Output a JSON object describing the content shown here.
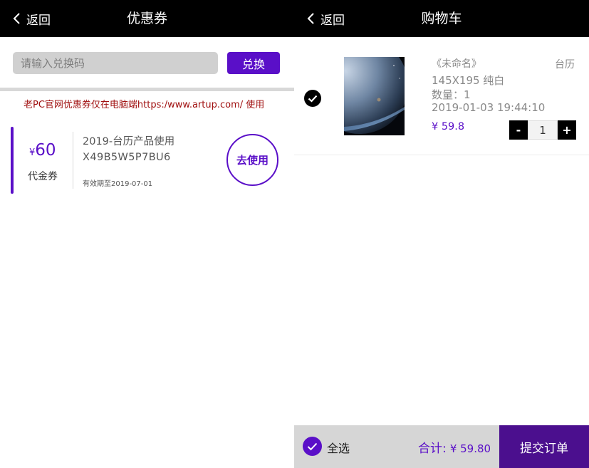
{
  "coupons_screen": {
    "back_label": "返回",
    "title": "优惠券",
    "redeem": {
      "placeholder": "请输入兑换码",
      "value": "",
      "button_label": "兑换"
    },
    "notice": "老PC官网优惠券仅在电脑端https:/www.artup.com/ 使用",
    "coupon": {
      "currency": "¥",
      "amount": "60",
      "type": "代金券",
      "title": "2019-台历产品使用",
      "code": "X49B5W5P7BU6",
      "expiry": "有效期至2019-07-01",
      "use_label": "去使用"
    }
  },
  "cart_screen": {
    "back_label": "返回",
    "title": "购物车",
    "item": {
      "selected": true,
      "name": "《未命名》",
      "category": "台历",
      "spec": "145X195 纯白",
      "quantity_text": "数量：1",
      "created_at": "2019-01-03 19:44:10",
      "price": "¥ 59.8",
      "quantity": "1",
      "minus_label": "-",
      "plus_label": "+"
    },
    "footer": {
      "select_all_label": "全选",
      "total_label": "合计:",
      "total_value": "¥ 59.80",
      "submit_label": "提交订单"
    }
  },
  "colors": {
    "accent": "#5a0fc8",
    "submit": "#4b0f8e",
    "topbar": "#000000",
    "notice_text": "#a01010"
  },
  "icons": [
    "chevron-left-icon",
    "checkmark-icon"
  ]
}
